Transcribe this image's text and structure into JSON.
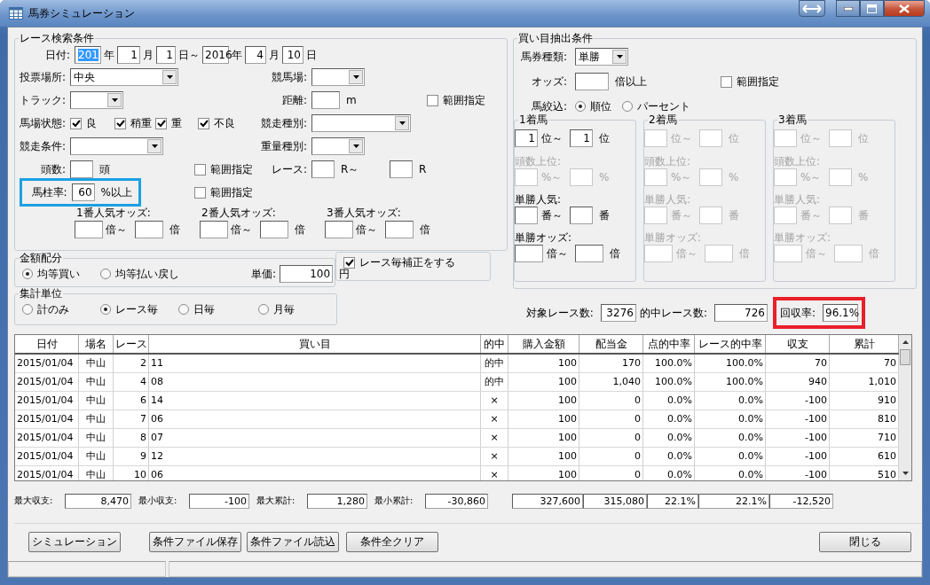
{
  "window": {
    "title": "馬券シミュレーション"
  },
  "race_search": {
    "title": "レース検索条件",
    "date": {
      "label": "日付:",
      "fields": [
        {
          "value": "201",
          "unit": "年",
          "selected": true
        },
        {
          "value": "1",
          "unit": "月",
          "selected": false
        },
        {
          "value": "1",
          "unit": "日～",
          "selected": false
        },
        {
          "value": "2016",
          "unit": "年",
          "selected": false
        },
        {
          "value": "4",
          "unit": "月",
          "selected": false
        },
        {
          "value": "10",
          "unit": "日",
          "selected": false
        }
      ]
    },
    "venue_type": {
      "label": "投票場所:",
      "value": "中央"
    },
    "racecourse": {
      "label": "競馬場:"
    },
    "track": {
      "label": "トラック:"
    },
    "distance": {
      "label": "距離:",
      "unit": "m",
      "range": {
        "label": "範囲指定",
        "checked": false
      }
    },
    "going": {
      "label": "馬場状態:",
      "options": [
        {
          "label": "良",
          "checked": true
        },
        {
          "label": "稍重",
          "checked": true
        },
        {
          "label": "重",
          "checked": true
        },
        {
          "label": "不良",
          "checked": true
        }
      ]
    },
    "race_type": {
      "label": "競走種別:"
    },
    "race_condition": {
      "label": "競走条件:"
    },
    "weight_type": {
      "label": "重量種別:"
    },
    "runners": {
      "label": "頭数:",
      "unit": "頭",
      "range": {
        "label": "範囲指定",
        "checked": false
      }
    },
    "race_no": {
      "label": "レース:",
      "unit_from": "R～",
      "unit_to": "R"
    },
    "umabashira": {
      "label": "馬柱率:",
      "value": "60",
      "unit": "%以上",
      "highlighted": true,
      "range": {
        "label": "範囲指定",
        "checked": false
      }
    },
    "popular_odds": [
      {
        "label": "1番人気オッズ:",
        "unit_from": "倍～",
        "unit_to": "倍"
      },
      {
        "label": "2番人気オッズ:",
        "unit_from": "倍～",
        "unit_to": "倍"
      },
      {
        "label": "3番人気オッズ:",
        "unit_from": "倍～",
        "unit_to": "倍"
      }
    ]
  },
  "allocation": {
    "title": "金額配分",
    "options": [
      {
        "label": "均等買い",
        "selected": true
      },
      {
        "label": "均等払い戻し",
        "selected": false
      }
    ],
    "unit_price": {
      "label": "単価:",
      "value": "100",
      "unit": "円"
    }
  },
  "race_correction": {
    "label": "レース毎補正をする",
    "checked": true
  },
  "aggregation": {
    "title": "集計単位",
    "options": [
      {
        "label": "計のみ",
        "selected": false
      },
      {
        "label": "レース毎",
        "selected": true
      },
      {
        "label": "日毎",
        "selected": false
      },
      {
        "label": "月毎",
        "selected": false
      }
    ]
  },
  "bet": {
    "title": "買い目抽出条件",
    "ticket_type": {
      "label": "馬券種類:",
      "value": "単勝"
    },
    "odds": {
      "label": "オッズ:",
      "unit": "倍以上",
      "range": {
        "label": "範囲指定",
        "checked": false
      }
    },
    "filter": {
      "label": "馬絞込:",
      "options": [
        {
          "label": "順位",
          "selected": true
        },
        {
          "label": "パーセント",
          "selected": false
        }
      ]
    },
    "places": [
      {
        "title": "1着馬",
        "rank": {
          "value_from": "1",
          "unit_from": "位～",
          "value_to": "1",
          "unit_to": "位",
          "disabled": false
        },
        "top_runners": {
          "label": "頭数上位:",
          "unit_from": "%～",
          "unit_to": "%",
          "disabled": true
        },
        "win_popularity": {
          "label": "単勝人気:",
          "unit_from": "番～",
          "unit_to": "番",
          "disabled": false
        },
        "win_odds": {
          "label": "単勝オッズ:",
          "unit_from": "倍～",
          "unit_to": "倍",
          "disabled": false
        }
      },
      {
        "title": "2着馬",
        "rank": {
          "unit_from": "位～",
          "unit_to": "位",
          "disabled": true
        },
        "top_runners": {
          "label": "頭数上位:",
          "unit_from": "%～",
          "unit_to": "%",
          "disabled": true
        },
        "win_popularity": {
          "label": "単勝人気:",
          "unit_from": "番～",
          "unit_to": "番",
          "disabled": true
        },
        "win_odds": {
          "label": "単勝オッズ:",
          "unit_from": "倍～",
          "unit_to": "倍",
          "disabled": true
        }
      },
      {
        "title": "3着馬",
        "rank": {
          "unit_from": "位～",
          "unit_to": "位",
          "disabled": true
        },
        "top_runners": {
          "label": "頭数上位:",
          "unit_from": "%～",
          "unit_to": "%",
          "disabled": true
        },
        "win_popularity": {
          "label": "単勝人気:",
          "unit_from": "番～",
          "unit_to": "番",
          "disabled": true
        },
        "win_odds": {
          "label": "単勝オッズ:",
          "unit_from": "倍～",
          "unit_to": "倍",
          "disabled": true
        }
      }
    ]
  },
  "counts": [
    {
      "label": "対象レース数:",
      "value": "3276"
    },
    {
      "label": "的中レース数:",
      "value": "726"
    },
    {
      "label": "回収率:",
      "value": "96.1%",
      "highlighted": true
    }
  ],
  "table": {
    "columns": [
      "日付",
      "場名",
      "レース",
      "買い目",
      "的中",
      "購入金額",
      "配当金",
      "点的中率",
      "レース的中率",
      "収支",
      "累計"
    ],
    "rows": [
      [
        "2015/01/04",
        "中山",
        "2",
        "11",
        "的中",
        "100",
        "170",
        "100.0%",
        "100.0%",
        "70",
        "70"
      ],
      [
        "2015/01/04",
        "中山",
        "4",
        "08",
        "的中",
        "100",
        "1,040",
        "100.0%",
        "100.0%",
        "940",
        "1,010"
      ],
      [
        "2015/01/04",
        "中山",
        "6",
        "14",
        "×",
        "100",
        "0",
        "0.0%",
        "0.0%",
        "-100",
        "910"
      ],
      [
        "2015/01/04",
        "中山",
        "7",
        "06",
        "×",
        "100",
        "0",
        "0.0%",
        "0.0%",
        "-100",
        "810"
      ],
      [
        "2015/01/04",
        "中山",
        "8",
        "07",
        "×",
        "100",
        "0",
        "0.0%",
        "0.0%",
        "-100",
        "710"
      ],
      [
        "2015/01/04",
        "中山",
        "9",
        "12",
        "×",
        "100",
        "0",
        "0.0%",
        "0.0%",
        "-100",
        "610"
      ],
      [
        "2015/01/04",
        "中山",
        "10",
        "06",
        "×",
        "100",
        "0",
        "0.0%",
        "0.0%",
        "-100",
        "510"
      ]
    ]
  },
  "summary": {
    "stats": [
      {
        "label": "最大収支:",
        "value": "8,470"
      },
      {
        "label": "最小収支:",
        "value": "-100"
      },
      {
        "label": "最大累計:",
        "value": "1,280"
      },
      {
        "label": "最小累計:",
        "value": "-30,860"
      }
    ],
    "totals": [
      "327,600",
      "315,080",
      "22.1%",
      "22.1%",
      "-12,520"
    ]
  },
  "buttons": [
    "シミュレーション",
    "条件ファイル保存",
    "条件ファイル読込",
    "条件全クリア"
  ],
  "close_button": "閉じる"
}
